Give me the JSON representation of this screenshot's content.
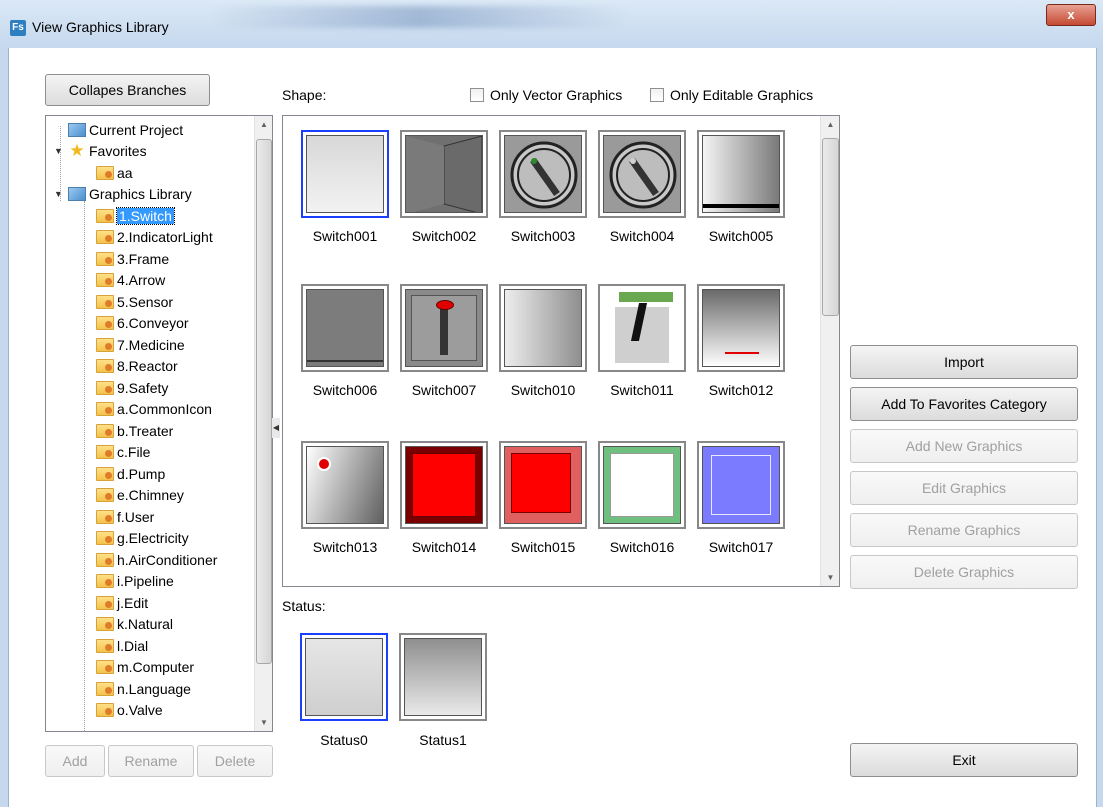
{
  "window": {
    "title": "View Graphics Library",
    "app_icon": "Fs",
    "close_glyph": "x"
  },
  "collapse_button": "Collapes Branches",
  "tree": {
    "items": [
      {
        "label": "Current Project",
        "icon": "project-icon"
      },
      {
        "label": "Favorites",
        "icon": "star-icon"
      },
      {
        "label": "aa",
        "icon": "folder-icon"
      },
      {
        "label": "Graphics Library",
        "icon": "project-icon"
      },
      {
        "label": "1.Switch",
        "icon": "folder-icon",
        "selected": true
      },
      {
        "label": "2.IndicatorLight",
        "icon": "folder-icon"
      },
      {
        "label": "3.Frame",
        "icon": "folder-icon"
      },
      {
        "label": "4.Arrow",
        "icon": "folder-icon"
      },
      {
        "label": "5.Sensor",
        "icon": "folder-icon"
      },
      {
        "label": "6.Conveyor",
        "icon": "folder-icon"
      },
      {
        "label": "7.Medicine",
        "icon": "folder-icon"
      },
      {
        "label": "8.Reactor",
        "icon": "folder-icon"
      },
      {
        "label": "9.Safety",
        "icon": "folder-icon"
      },
      {
        "label": "a.CommonIcon",
        "icon": "folder-icon"
      },
      {
        "label": "b.Treater",
        "icon": "folder-icon"
      },
      {
        "label": "c.File",
        "icon": "folder-icon"
      },
      {
        "label": "d.Pump",
        "icon": "folder-icon"
      },
      {
        "label": "e.Chimney",
        "icon": "folder-icon"
      },
      {
        "label": "f.User",
        "icon": "folder-icon"
      },
      {
        "label": "g.Electricity",
        "icon": "folder-icon"
      },
      {
        "label": "h.AirConditioner",
        "icon": "folder-icon"
      },
      {
        "label": "i.Pipeline",
        "icon": "folder-icon"
      },
      {
        "label": "j.Edit",
        "icon": "folder-icon"
      },
      {
        "label": "k.Natural",
        "icon": "folder-icon"
      },
      {
        "label": "l.Dial",
        "icon": "folder-icon"
      },
      {
        "label": "m.Computer",
        "icon": "folder-icon"
      },
      {
        "label": "n.Language",
        "icon": "folder-icon"
      },
      {
        "label": "o.Valve",
        "icon": "folder-icon"
      }
    ]
  },
  "tree_buttons": {
    "add": "Add",
    "rename": "Rename",
    "delete": "Delete"
  },
  "shape_label": "Shape:",
  "filters": {
    "vector_only": "Only Vector Graphics",
    "editable_only": "Only Editable Graphics"
  },
  "shapes": [
    {
      "name": "Switch001"
    },
    {
      "name": "Switch002"
    },
    {
      "name": "Switch003"
    },
    {
      "name": "Switch004"
    },
    {
      "name": "Switch005"
    },
    {
      "name": "Switch006"
    },
    {
      "name": "Switch007"
    },
    {
      "name": "Switch010"
    },
    {
      "name": "Switch011"
    },
    {
      "name": "Switch012"
    },
    {
      "name": "Switch013"
    },
    {
      "name": "Switch014"
    },
    {
      "name": "Switch015"
    },
    {
      "name": "Switch016"
    },
    {
      "name": "Switch017"
    }
  ],
  "status_label": "Status:",
  "statuses": [
    {
      "name": "Status0"
    },
    {
      "name": "Status1"
    }
  ],
  "actions": {
    "import": "Import",
    "add_favorites": "Add To Favorites Category",
    "add_new": "Add New Graphics",
    "edit": "Edit Graphics",
    "rename": "Rename Graphics",
    "delete": "Delete Graphics",
    "exit": "Exit"
  }
}
